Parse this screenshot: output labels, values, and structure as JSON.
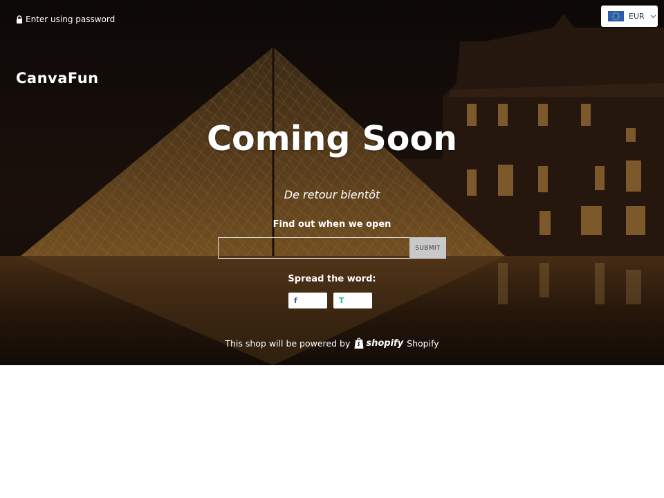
{
  "header": {
    "login_link": "Enter using password",
    "currency": "EUR",
    "logo": "CanvaFun"
  },
  "hero": {
    "title": "Coming Soon",
    "message": "De retour bientôt"
  },
  "signup": {
    "label": "Find out when we open",
    "email_value": "",
    "email_placeholder": "",
    "submit_label": "SUBMIT"
  },
  "share": {
    "label": "Spread the word:",
    "facebook_glyph": "f",
    "twitter_glyph": "T"
  },
  "footer": {
    "powered_text": "This shop will be powered by",
    "shopify_wordmark": "shopify",
    "shopify_text": "Shopify"
  },
  "icons": {
    "lock": "lock-icon",
    "flag": "eu-flag-icon",
    "chevron": "chevron-down-icon",
    "facebook": "facebook-icon",
    "twitter": "twitter-icon",
    "shopify": "shopify-bag-icon"
  },
  "colors": {
    "text": "#ffffff",
    "submit_bg": "#c9c9c9",
    "facebook": "#3b5998",
    "twitter": "#25b6a8"
  }
}
